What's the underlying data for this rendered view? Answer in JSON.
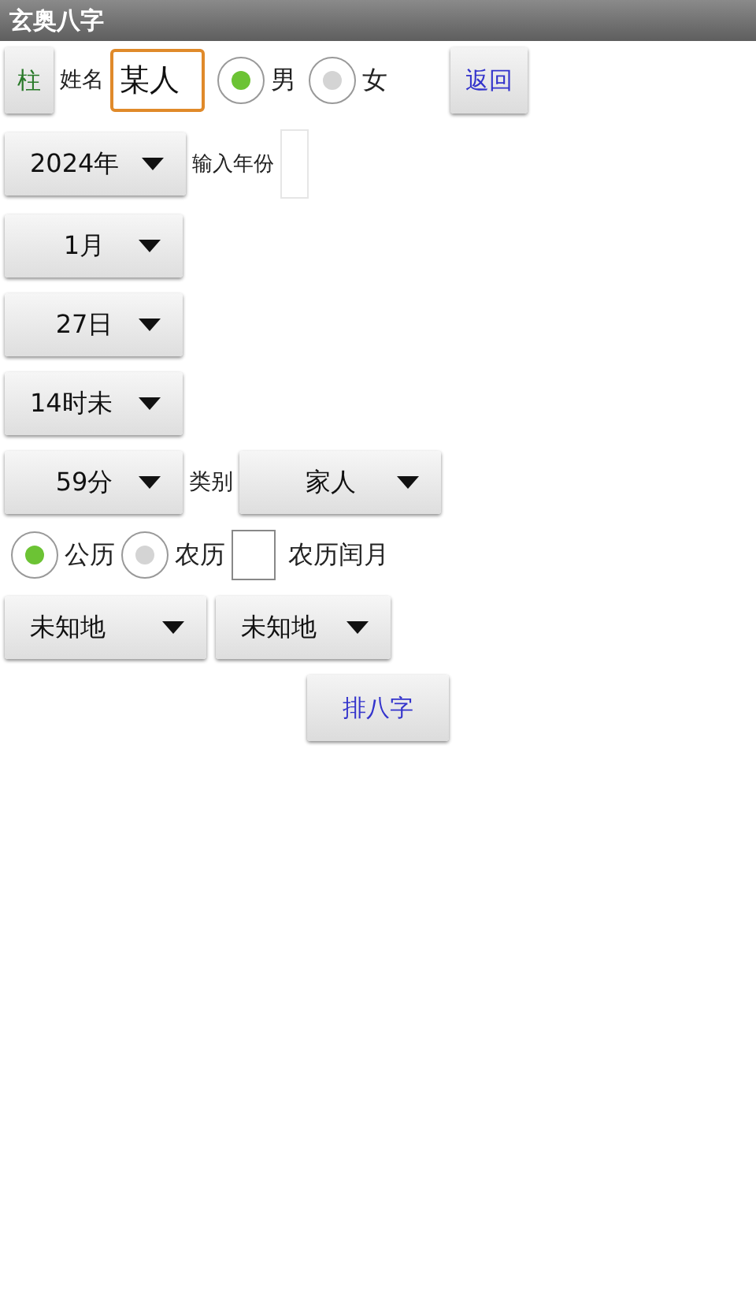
{
  "title": "玄奥八字",
  "top_row": {
    "pillar_button": "柱",
    "name_label": "姓名",
    "name_value": "某人",
    "genders": [
      {
        "label": "男",
        "selected": true
      },
      {
        "label": "女",
        "selected": false
      }
    ],
    "back_button": "返回"
  },
  "year": {
    "value": "2024年",
    "input_label": "输入年份"
  },
  "month": "1月",
  "day": "27日",
  "hour": "14时未",
  "minute": "59分",
  "category": {
    "label": "类别",
    "value": "家人"
  },
  "calendar": {
    "options": [
      {
        "label": "公历",
        "selected": true
      },
      {
        "label": "农历",
        "selected": false
      }
    ],
    "leap_month": {
      "label": "农历闰月",
      "checked": false
    }
  },
  "places": [
    "未知地",
    "未知地"
  ],
  "submit_button": "排八字"
}
